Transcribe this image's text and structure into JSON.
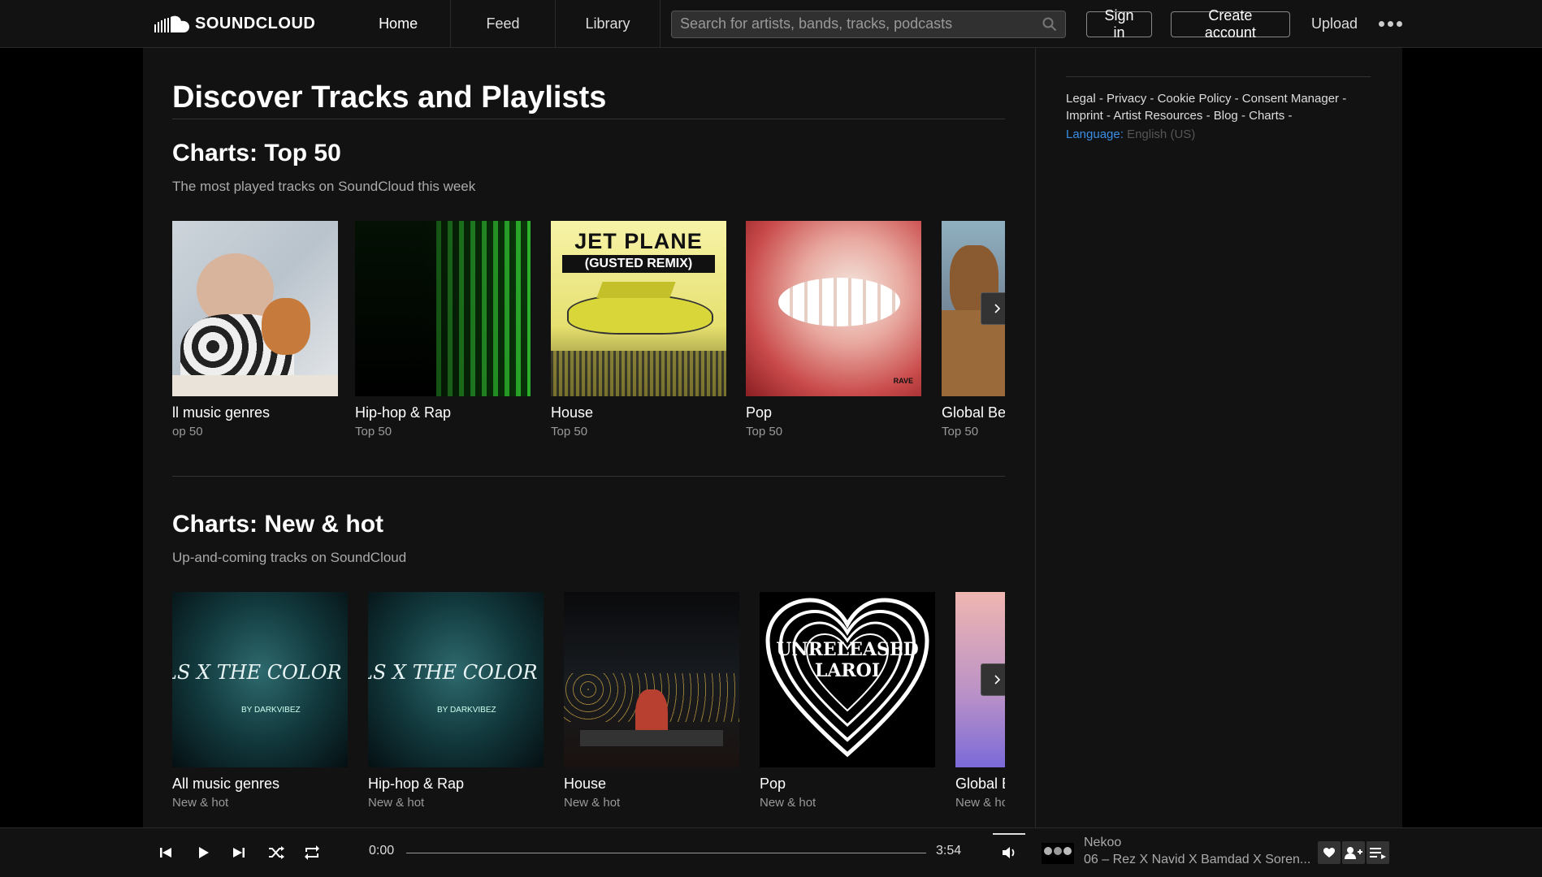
{
  "header": {
    "logo_text": "SOUNDCLOUD",
    "nav": [
      "Home",
      "Feed",
      "Library"
    ],
    "search_placeholder": "Search for artists, bands, tracks, podcasts",
    "signin_label": "Sign in",
    "create_label": "Create account",
    "upload_label": "Upload"
  },
  "page": {
    "title": "Discover Tracks and Playlists"
  },
  "sections": [
    {
      "title": "Charts: Top 50",
      "subtitle": "The most played tracks on SoundCloud this week",
      "cards": [
        {
          "name": "ll music genres",
          "sub": "op 50"
        },
        {
          "name": "Hip-hop & Rap",
          "sub": "Top 50"
        },
        {
          "name": "House",
          "sub": "Top 50"
        },
        {
          "name": "Pop",
          "sub": "Top 50"
        },
        {
          "name": "Global Be",
          "sub": "Top 50"
        }
      ],
      "art_text": {
        "jet1": "JET PLANE",
        "jet2": "(GUSTED REMIX)",
        "rave": "RAVE"
      }
    },
    {
      "title": "Charts: New & hot",
      "subtitle": "Up-and-coming tracks on SoundCloud",
      "cards": [
        {
          "name": "All music genres",
          "sub": "New & hot"
        },
        {
          "name": "Hip-hop & Rap",
          "sub": "New & hot"
        },
        {
          "name": "House",
          "sub": "New & hot"
        },
        {
          "name": "Pop",
          "sub": "New & hot"
        },
        {
          "name": "Global E",
          "sub": "New & ho"
        }
      ],
      "art_text": {
        "violet": "LS X THE COLOR VIOLET X C",
        "by": "BY DARKVIBEZ",
        "laroi": "UNRELEASED LAROI"
      }
    }
  ],
  "sidebar": {
    "links": [
      "Legal",
      "Privacy",
      "Cookie Policy",
      "Consent Manager",
      "Imprint",
      "Artist Resources",
      "Blog",
      "Charts"
    ],
    "language_label": "Language:",
    "language_value": "English (US)"
  },
  "player": {
    "elapsed": "0:00",
    "duration": "3:54",
    "artist": "Nekoo",
    "title": "06 – Rez X Navid X Bamdad X Soren...",
    "progress": 0
  },
  "colors": {
    "background": "#121212",
    "accent_link": "#3a8ee6"
  }
}
